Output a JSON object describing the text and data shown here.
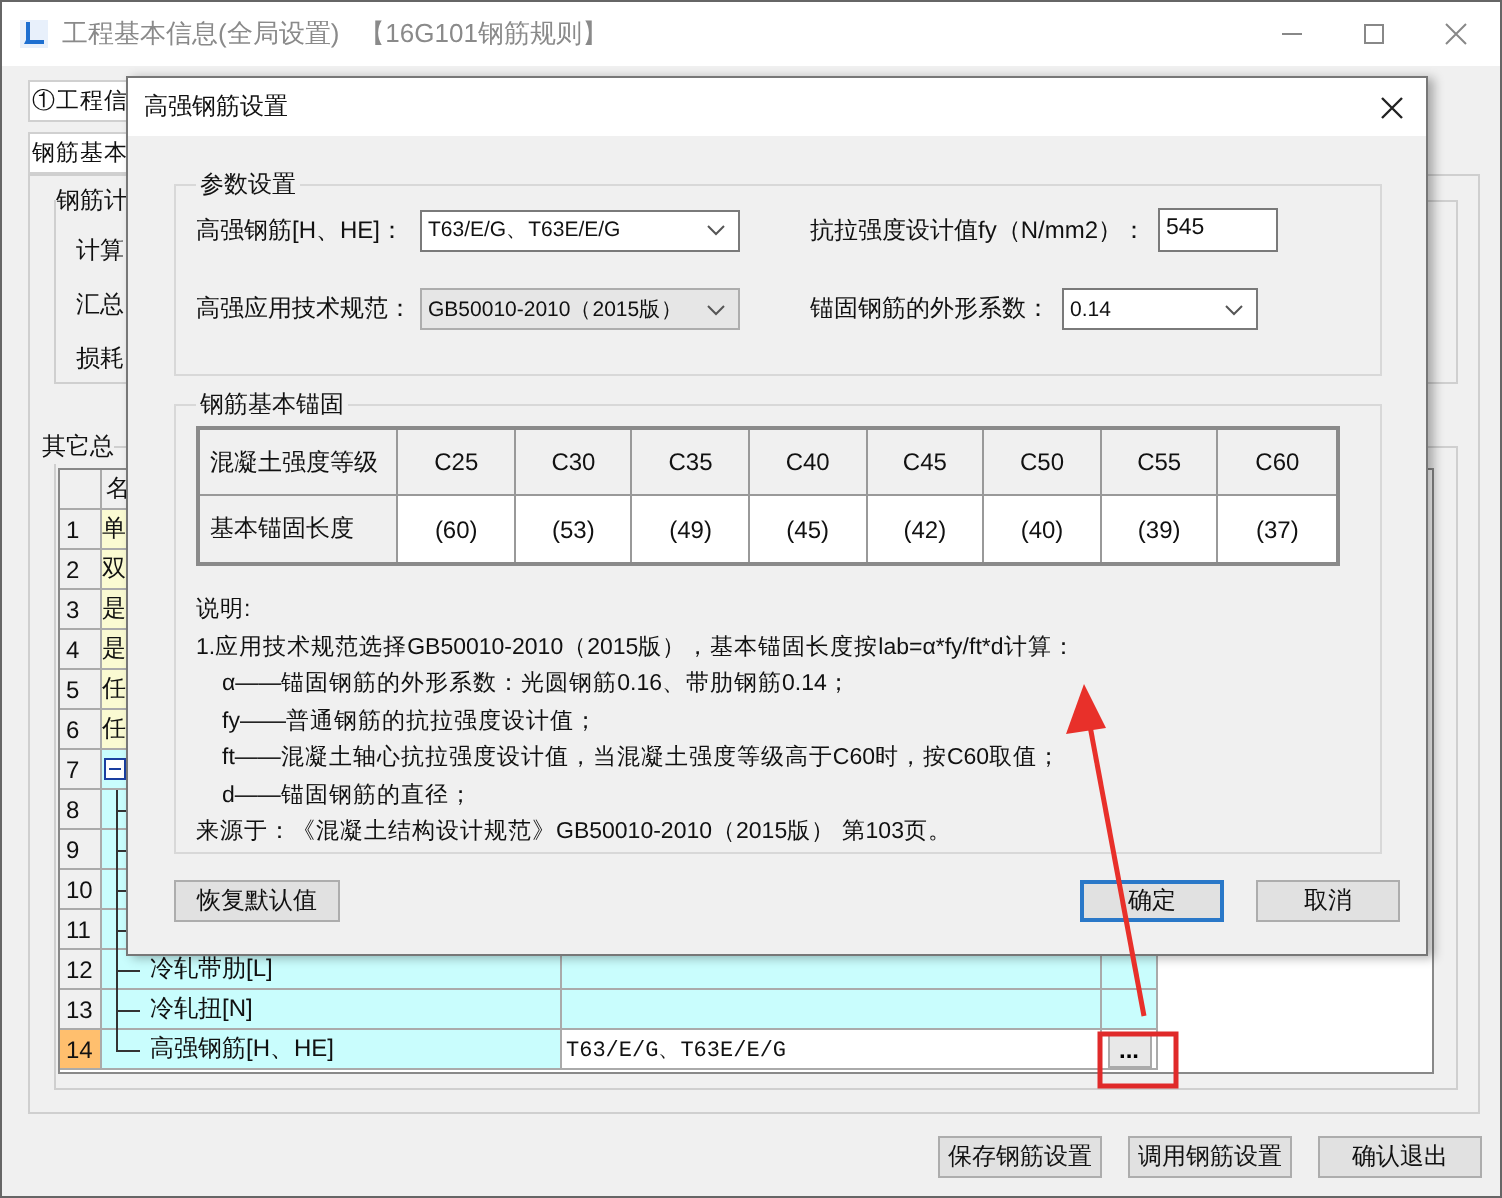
{
  "window": {
    "title": "工程基本信息(全局设置)",
    "subtitle": "【16G101钢筋规则】"
  },
  "tabs": [
    {
      "label": "①工程信",
      "selected": true
    }
  ],
  "subtabs": [
    {
      "label": "钢筋基本",
      "selected": true
    }
  ],
  "calc_group": {
    "title": "钢筋计",
    "labels": [
      "计算",
      "汇总",
      "损耗"
    ]
  },
  "other_group": {
    "title": "其它总",
    "table": {
      "columns": [
        "名"
      ],
      "rows": [
        {
          "num": "1",
          "name": "单",
          "selected": false
        },
        {
          "num": "2",
          "name": "双",
          "selected": false
        },
        {
          "num": "3",
          "name": "是",
          "selected": false
        },
        {
          "num": "4",
          "name": "是",
          "selected": false
        },
        {
          "num": "5",
          "name": "任",
          "selected": false
        },
        {
          "num": "6",
          "name": "任",
          "selected": false
        },
        {
          "num": "7",
          "expanded": true,
          "selected": false,
          "children": [
            {
              "num": "8",
              "selected": false
            },
            {
              "num": "9",
              "selected": false
            },
            {
              "num": "10",
              "selected": false
            },
            {
              "num": "11",
              "selected": false
            },
            {
              "num": "12",
              "name": "冷轧带肋[L]",
              "selected": false
            },
            {
              "num": "13",
              "name": "冷轧扭[N]",
              "selected": false
            },
            {
              "num": "14",
              "name": "高强钢筋[H、HE]",
              "value": "T63/E/G、T63E/E/G",
              "button": "...",
              "selected": true
            }
          ]
        }
      ]
    }
  },
  "buttons": [
    "保存钢筋设置",
    "调用钢筋设置",
    "确认退出"
  ],
  "dialog": {
    "title": "高强钢筋设置",
    "params": {
      "title": "参数设置",
      "fields": [
        {
          "label": "高强钢筋[H、HE]：",
          "kind": "combo",
          "value": "T63/E/G、T63E/E/G",
          "disabled": false
        },
        {
          "label": "抗拉强度设计值fy（N/mm2）：",
          "kind": "input",
          "value": "545",
          "disabled": false
        },
        {
          "label": "高强应用技术规范：",
          "kind": "combo",
          "value": "GB50010-2010（2015版）",
          "disabled": true
        },
        {
          "label": "锚固钢筋的外形系数：",
          "kind": "combo",
          "value": "0.14",
          "disabled": false
        }
      ]
    },
    "anchorage": {
      "title": "钢筋基本锚固",
      "header": "混凝土强度等级",
      "grades": [
        "C25",
        "C30",
        "C35",
        "C40",
        "C45",
        "C50",
        "C55",
        "C60"
      ],
      "row_label": "基本锚固长度",
      "values": [
        "(60)",
        "(53)",
        "(49)",
        "(45)",
        "(42)",
        "(40)",
        "(39)",
        "(37)"
      ],
      "notes": [
        {
          "kind": "heading",
          "text": "说明:"
        },
        {
          "kind": "item",
          "text": "1.应用技术规范选择GB50010-2010（2015版），基本锚固长度按lab=α*fy/ft*d计算："
        },
        {
          "kind": "sub",
          "text": "α——锚固钢筋的外形系数：光圆钢筋0.16、带肋钢筋0.14；"
        },
        {
          "kind": "sub",
          "text": "fy——普通钢筋的抗拉强度设计值；"
        },
        {
          "kind": "sub",
          "text": "ft——混凝土轴心抗拉强度设计值，当混凝土强度等级高于C60时，按C60取值；"
        },
        {
          "kind": "sub",
          "text": "d——锚固钢筋的直径；"
        },
        {
          "kind": "item",
          "text": "来源于：《混凝土结构设计规范》GB50010-2010（2015版） 第103页。"
        }
      ]
    },
    "buttons": [
      {
        "label": "恢复默认值",
        "default": false
      },
      {
        "label": "确定",
        "default": true
      },
      {
        "label": "取消",
        "default": false
      }
    ]
  }
}
